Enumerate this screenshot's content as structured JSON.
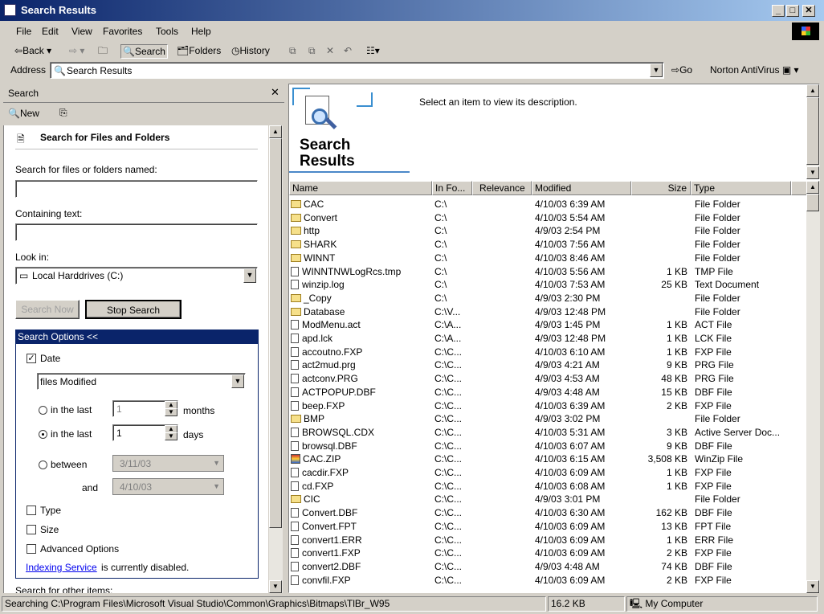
{
  "window": {
    "title": "Search Results"
  },
  "menu": [
    "File",
    "Edit",
    "View",
    "Favorites",
    "Tools",
    "Help"
  ],
  "toolbar": {
    "back": "Back",
    "search": "Search",
    "folders": "Folders",
    "history": "History"
  },
  "address": {
    "label": "Address",
    "value": "Search Results",
    "go": "Go",
    "norton": "Norton AntiVirus"
  },
  "search_pane": {
    "title": "Search",
    "new_label": "New",
    "heading": "Search for Files and Folders",
    "name_label": "Search for files or folders named:",
    "name_value": "",
    "containing_label": "Containing text:",
    "containing_value": "",
    "lookin_label": "Look in:",
    "lookin_value": "Local Harddrives (C:)",
    "search_now": "Search Now",
    "stop_search": "Stop Search",
    "options_header": "Search Options <<",
    "date_label": "Date",
    "date_mode": "files Modified",
    "in_last_label": "in the last",
    "months_value": "1",
    "months_label": "months",
    "days_value": "1",
    "days_label": "days",
    "between_label": "between",
    "between_from": "3/11/03",
    "and_label": "and",
    "between_to": "4/10/03",
    "type_label": "Type",
    "size_label": "Size",
    "advanced_label": "Advanced Options",
    "indexing_link": "Indexing Service",
    "indexing_text": "is currently disabled.",
    "other_items": "Search for other items:"
  },
  "results": {
    "banner_title_line1": "Search",
    "banner_title_line2": "Results",
    "description": "Select an item to view its description.",
    "columns": [
      "Name",
      "In Fo...",
      "Relevance",
      "Modified",
      "Size",
      "Type"
    ],
    "rows": [
      {
        "icon": "folder",
        "name": "CAC",
        "in": "C:\\",
        "modified": "4/10/03 6:39 AM",
        "size": "",
        "type": "File Folder"
      },
      {
        "icon": "folder",
        "name": "Convert",
        "in": "C:\\",
        "modified": "4/10/03 5:54 AM",
        "size": "",
        "type": "File Folder"
      },
      {
        "icon": "folder",
        "name": "http",
        "in": "C:\\",
        "modified": "4/9/03 2:54 PM",
        "size": "",
        "type": "File Folder"
      },
      {
        "icon": "folder",
        "name": "SHARK",
        "in": "C:\\",
        "modified": "4/10/03 7:56 AM",
        "size": "",
        "type": "File Folder"
      },
      {
        "icon": "folder",
        "name": "WINNT",
        "in": "C:\\",
        "modified": "4/10/03 8:46 AM",
        "size": "",
        "type": "File Folder"
      },
      {
        "icon": "file",
        "name": "WINNTNWLogRcs.tmp",
        "in": "C:\\",
        "modified": "4/10/03 5:56 AM",
        "size": "1 KB",
        "type": "TMP File"
      },
      {
        "icon": "file",
        "name": "winzip.log",
        "in": "C:\\",
        "modified": "4/10/03 7:53 AM",
        "size": "25 KB",
        "type": "Text Document"
      },
      {
        "icon": "folder",
        "name": "_Copy",
        "in": "C:\\",
        "modified": "4/9/03 2:30 PM",
        "size": "",
        "type": "File Folder"
      },
      {
        "icon": "folder",
        "name": "Database",
        "in": "C:\\V...",
        "modified": "4/9/03 12:48 PM",
        "size": "",
        "type": "File Folder"
      },
      {
        "icon": "file",
        "name": "ModMenu.act",
        "in": "C:\\A...",
        "modified": "4/9/03 1:45 PM",
        "size": "1 KB",
        "type": "ACT File"
      },
      {
        "icon": "file",
        "name": "apd.lck",
        "in": "C:\\A...",
        "modified": "4/9/03 12:48 PM",
        "size": "1 KB",
        "type": "LCK File"
      },
      {
        "icon": "file",
        "name": "accoutno.FXP",
        "in": "C:\\C...",
        "modified": "4/10/03 6:10 AM",
        "size": "1 KB",
        "type": "FXP File"
      },
      {
        "icon": "file",
        "name": "act2mud.prg",
        "in": "C:\\C...",
        "modified": "4/9/03 4:21 AM",
        "size": "9 KB",
        "type": "PRG File"
      },
      {
        "icon": "file",
        "name": "actconv.PRG",
        "in": "C:\\C...",
        "modified": "4/9/03 4:53 AM",
        "size": "48 KB",
        "type": "PRG File"
      },
      {
        "icon": "file",
        "name": "ACTPOPUP.DBF",
        "in": "C:\\C...",
        "modified": "4/9/03 4:48 AM",
        "size": "15 KB",
        "type": "DBF File"
      },
      {
        "icon": "file",
        "name": "beep.FXP",
        "in": "C:\\C...",
        "modified": "4/10/03 6:39 AM",
        "size": "2 KB",
        "type": "FXP File"
      },
      {
        "icon": "folder",
        "name": "BMP",
        "in": "C:\\C...",
        "modified": "4/9/03 3:02 PM",
        "size": "",
        "type": "File Folder"
      },
      {
        "icon": "file",
        "name": "BROWSQL.CDX",
        "in": "C:\\C...",
        "modified": "4/10/03 5:31 AM",
        "size": "3 KB",
        "type": "Active Server Doc..."
      },
      {
        "icon": "file",
        "name": "browsql.DBF",
        "in": "C:\\C...",
        "modified": "4/10/03 6:07 AM",
        "size": "9 KB",
        "type": "DBF File"
      },
      {
        "icon": "zip",
        "name": "CAC.ZIP",
        "in": "C:\\C...",
        "modified": "4/10/03 6:15 AM",
        "size": "3,508 KB",
        "type": "WinZip File"
      },
      {
        "icon": "file",
        "name": "cacdir.FXP",
        "in": "C:\\C...",
        "modified": "4/10/03 6:09 AM",
        "size": "1 KB",
        "type": "FXP File"
      },
      {
        "icon": "file",
        "name": "cd.FXP",
        "in": "C:\\C...",
        "modified": "4/10/03 6:08 AM",
        "size": "1 KB",
        "type": "FXP File"
      },
      {
        "icon": "folder",
        "name": "CIC",
        "in": "C:\\C...",
        "modified": "4/9/03 3:01 PM",
        "size": "",
        "type": "File Folder"
      },
      {
        "icon": "file",
        "name": "Convert.DBF",
        "in": "C:\\C...",
        "modified": "4/10/03 6:30 AM",
        "size": "162 KB",
        "type": "DBF File"
      },
      {
        "icon": "file",
        "name": "Convert.FPT",
        "in": "C:\\C...",
        "modified": "4/10/03 6:09 AM",
        "size": "13 KB",
        "type": "FPT File"
      },
      {
        "icon": "file",
        "name": "convert1.ERR",
        "in": "C:\\C...",
        "modified": "4/10/03 6:09 AM",
        "size": "1 KB",
        "type": "ERR File"
      },
      {
        "icon": "file",
        "name": "convert1.FXP",
        "in": "C:\\C...",
        "modified": "4/10/03 6:09 AM",
        "size": "2 KB",
        "type": "FXP File"
      },
      {
        "icon": "file",
        "name": "convert2.DBF",
        "in": "C:\\C...",
        "modified": "4/9/03 4:48 AM",
        "size": "74 KB",
        "type": "DBF File"
      },
      {
        "icon": "file",
        "name": "convfil.FXP",
        "in": "C:\\C...",
        "modified": "4/10/03 6:09 AM",
        "size": "2 KB",
        "type": "FXP File"
      }
    ]
  },
  "status": {
    "text": "Searching C:\\Program Files\\Microsoft Visual Studio\\Common\\Graphics\\Bitmaps\\TlBr_W95",
    "size": "16.2 KB",
    "zone": "My Computer"
  }
}
